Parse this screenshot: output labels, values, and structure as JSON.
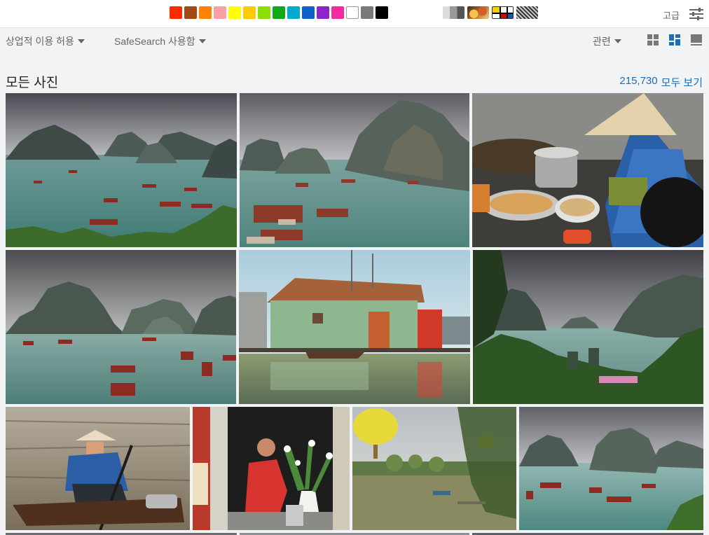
{
  "colors": {
    "swatches": [
      "#ff2a00",
      "#a34a16",
      "#ff8100",
      "#f9a0a5",
      "#ffff00",
      "#ffcc00",
      "#8ae000",
      "#13a81b",
      "#00aacc",
      "#0d60c9",
      "#8d26c9",
      "#f22ba0",
      "#ffffff",
      "#7a7a7a",
      "#000000"
    ],
    "link": "#1a6fb5",
    "active_view": "#1a6fb5"
  },
  "toolbar": {
    "advanced_label": "고급",
    "settings_icon": "sliders-icon"
  },
  "filters": {
    "license": "상업적 이용 허용",
    "safesearch": "SafeSearch 사용함",
    "sort": "관련"
  },
  "section": {
    "title": "모든 사진",
    "count": "215,730",
    "view_all": "모두 보기"
  }
}
